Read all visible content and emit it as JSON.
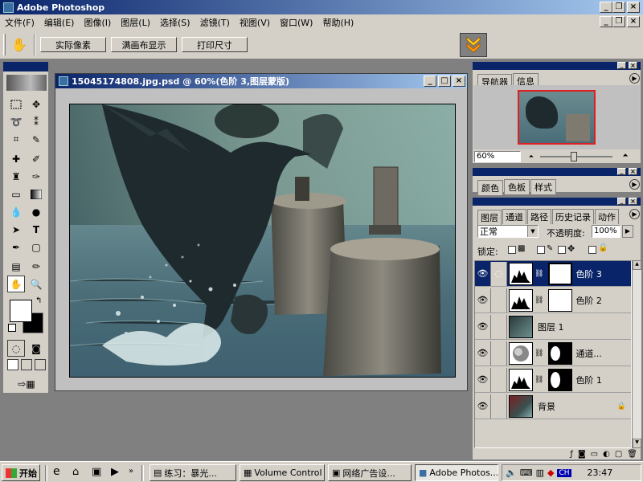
{
  "app": {
    "title": "Adobe Photoshop"
  },
  "menu": [
    "文件(F)",
    "编辑(E)",
    "图像(I)",
    "图层(L)",
    "选择(S)",
    "滤镜(T)",
    "视图(V)",
    "窗口(W)",
    "帮助(H)"
  ],
  "options": {
    "actual_pixels": "实际像素",
    "fit_on_screen": "满画布显示",
    "print_size": "打印尺寸"
  },
  "document": {
    "title": "15045174808.jpg.psd @ 60%(色阶 3,图层蒙版)"
  },
  "navigator": {
    "tabs": [
      "导航器",
      "信息"
    ],
    "zoom": "60%"
  },
  "color_panel": {
    "tabs": [
      "颜色",
      "色板",
      "样式"
    ]
  },
  "layers_panel": {
    "tabs": [
      "图层",
      "通道",
      "路径",
      "历史记录",
      "动作"
    ],
    "blend_mode": "正常",
    "opacity_label": "不透明度:",
    "opacity_value": "100%",
    "lock_label": "锁定:",
    "layers": [
      {
        "name": "色阶 3",
        "selected": true
      },
      {
        "name": "色阶 2",
        "selected": false
      },
      {
        "name": "图层 1",
        "selected": false
      },
      {
        "name": "通道...",
        "selected": false
      },
      {
        "name": "色阶 1",
        "selected": false
      },
      {
        "name": "背景",
        "selected": false
      }
    ]
  },
  "taskbar": {
    "start": "开始",
    "items": [
      "练习：暴光...",
      "Volume Control",
      "网络广告设...",
      "Adobe Photos..."
    ],
    "ime": "CH",
    "clock": "23:47"
  },
  "colors": {
    "titlebar": "#0a246a",
    "selected_layer": "#0a246a",
    "face": "#d4d0c8"
  }
}
